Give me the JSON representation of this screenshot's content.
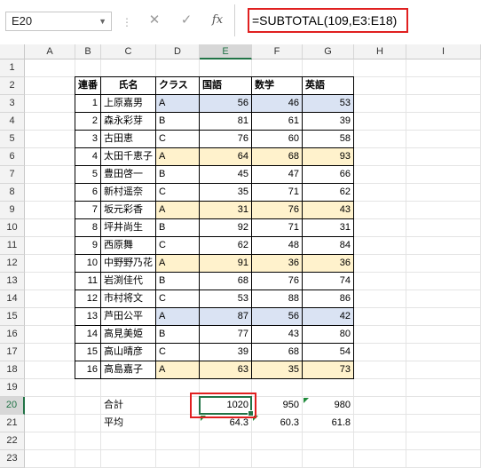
{
  "formula_bar": {
    "name_box": "E20",
    "formula": "=SUBTOTAL(109,E3:E18)",
    "icons": [
      "chevron-down-icon",
      "cancel-icon",
      "confirm-icon",
      "function-icon"
    ]
  },
  "columns": [
    "A",
    "B",
    "C",
    "D",
    "E",
    "F",
    "G",
    "H",
    "I"
  ],
  "rows": [
    "1",
    "2",
    "3",
    "4",
    "5",
    "6",
    "7",
    "8",
    "9",
    "10",
    "11",
    "12",
    "13",
    "14",
    "15",
    "16",
    "17",
    "18",
    "19",
    "20",
    "21",
    "22",
    "23"
  ],
  "table": {
    "headers": [
      "連番",
      "氏名",
      "クラス",
      "国語",
      "数学",
      "英語"
    ],
    "records": [
      {
        "no": "1",
        "name": "上原嘉男",
        "cls": "A",
        "kokugo": "56",
        "sugaku": "46",
        "eigo": "53",
        "fill": "blue"
      },
      {
        "no": "2",
        "name": "森永彩芽",
        "cls": "B",
        "kokugo": "81",
        "sugaku": "61",
        "eigo": "39",
        "fill": ""
      },
      {
        "no": "3",
        "name": "古田恵",
        "cls": "C",
        "kokugo": "76",
        "sugaku": "60",
        "eigo": "58",
        "fill": ""
      },
      {
        "no": "4",
        "name": "太田千恵子",
        "cls": "A",
        "kokugo": "64",
        "sugaku": "68",
        "eigo": "93",
        "fill": "yellow"
      },
      {
        "no": "5",
        "name": "豊田啓一",
        "cls": "B",
        "kokugo": "45",
        "sugaku": "47",
        "eigo": "66",
        "fill": ""
      },
      {
        "no": "6",
        "name": "新村遥奈",
        "cls": "C",
        "kokugo": "35",
        "sugaku": "71",
        "eigo": "62",
        "fill": ""
      },
      {
        "no": "7",
        "name": "坂元彩香",
        "cls": "A",
        "kokugo": "31",
        "sugaku": "76",
        "eigo": "43",
        "fill": "yellow"
      },
      {
        "no": "8",
        "name": "坪井尚生",
        "cls": "B",
        "kokugo": "92",
        "sugaku": "71",
        "eigo": "31",
        "fill": ""
      },
      {
        "no": "9",
        "name": "西原舞",
        "cls": "C",
        "kokugo": "62",
        "sugaku": "48",
        "eigo": "84",
        "fill": ""
      },
      {
        "no": "10",
        "name": "中野野乃花",
        "cls": "A",
        "kokugo": "91",
        "sugaku": "36",
        "eigo": "36",
        "fill": "yellow"
      },
      {
        "no": "11",
        "name": "岩渕佳代",
        "cls": "B",
        "kokugo": "68",
        "sugaku": "76",
        "eigo": "74",
        "fill": ""
      },
      {
        "no": "12",
        "name": "市村将文",
        "cls": "C",
        "kokugo": "53",
        "sugaku": "88",
        "eigo": "86",
        "fill": ""
      },
      {
        "no": "13",
        "name": "芦田公平",
        "cls": "A",
        "kokugo": "87",
        "sugaku": "56",
        "eigo": "42",
        "fill": "blue"
      },
      {
        "no": "14",
        "name": "高見美姫",
        "cls": "B",
        "kokugo": "77",
        "sugaku": "43",
        "eigo": "80",
        "fill": ""
      },
      {
        "no": "15",
        "name": "高山晴彦",
        "cls": "C",
        "kokugo": "39",
        "sugaku": "68",
        "eigo": "54",
        "fill": ""
      },
      {
        "no": "16",
        "name": "高島嘉子",
        "cls": "A",
        "kokugo": "63",
        "sugaku": "35",
        "eigo": "73",
        "fill": "yellow"
      }
    ]
  },
  "summary": {
    "total_label": "合計",
    "total": [
      "1020",
      "950",
      "980"
    ],
    "avg_label": "平均",
    "avg": [
      "64.3",
      "60.3",
      "61.8"
    ]
  },
  "colors": {
    "accent": "#217346",
    "highlight": "#e02020",
    "fill_blue": "#dae3f3",
    "fill_yellow": "#fff2cc"
  }
}
